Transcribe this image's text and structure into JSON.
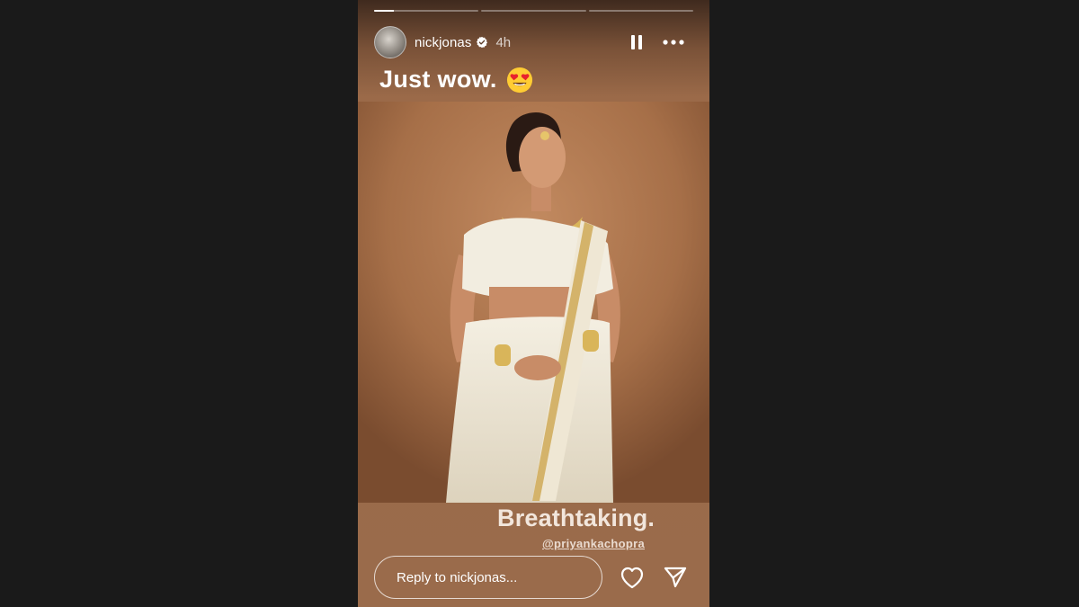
{
  "story": {
    "progress": [
      0.19,
      0,
      0
    ],
    "user": {
      "username": "nickjonas",
      "time": "4h",
      "verified": true
    },
    "caption": {
      "text": "Just wow.",
      "emoji": "heart-eyes-emoji"
    },
    "photo_subject": "woman-in-white-saree-photo",
    "overlay_text": "Breathtaking.",
    "mention": "@priyankachopra",
    "reply_placeholder": "Reply to nickjonas...",
    "icons": {
      "pause": "pause-icon",
      "more": "more-icon",
      "like": "heart-icon",
      "share": "send-icon"
    },
    "colors": {
      "accent": "#ffffff",
      "background": "#9a6b4b",
      "frame": "#1a1a1a"
    }
  }
}
